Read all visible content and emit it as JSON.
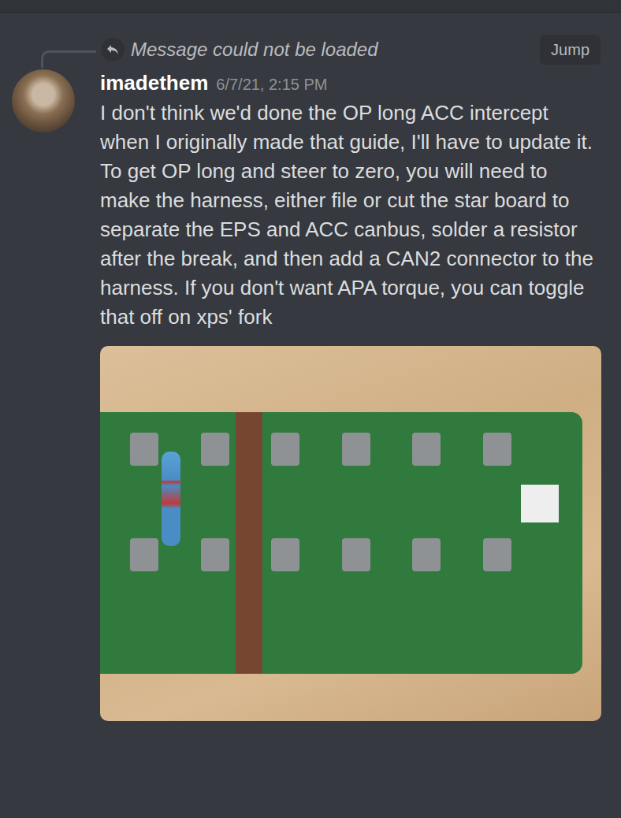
{
  "reply": {
    "text": "Message could not be loaded",
    "jump": "Jump"
  },
  "message": {
    "author": "imadethem",
    "timestamp": "6/7/21, 2:15 PM",
    "text": "I don't think we'd done the OP long ACC intercept when I originally made that guide, I'll have to update it. To get OP long and steer to zero, you will need to make the harness, either file or cut the star board to separate the EPS and ACC canbus, solder a resistor after the break, and then add a CAN2 connector to the harness. If you don't want APA torque, you can toggle that off on xps' fork"
  }
}
